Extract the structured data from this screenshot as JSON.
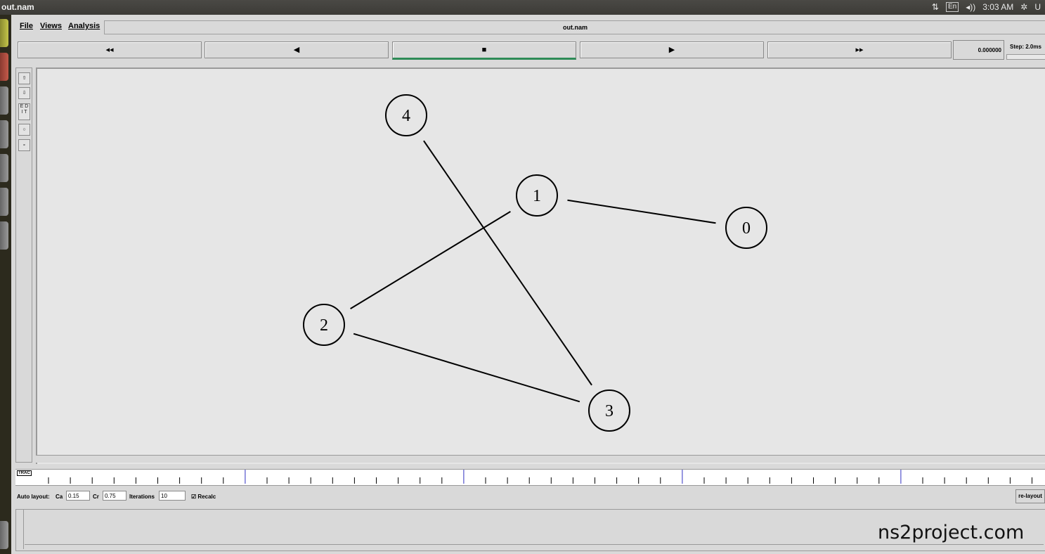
{
  "topbar": {
    "window_title": "out.nam",
    "keyboard_lang": "En",
    "clock": "3:03 AM",
    "user_initial": "U"
  },
  "menu": {
    "file": "File",
    "views": "Views",
    "analysis": "Analysis",
    "title_field": "out.nam"
  },
  "controls": {
    "fast_rewind": "◂◂",
    "rewind": "◀",
    "stop": "■",
    "play": "▶",
    "fast_forward": "▸▸",
    "time": "0.000000",
    "step": "Step: 2.0ms"
  },
  "tools": {
    "edit": "E D I T"
  },
  "graph": {
    "nodes": [
      {
        "id": "0"
      },
      {
        "id": "1"
      },
      {
        "id": "2"
      },
      {
        "id": "3"
      },
      {
        "id": "4"
      }
    ],
    "links": [
      [
        "1",
        "0"
      ],
      [
        "1",
        "2"
      ],
      [
        "2",
        "3"
      ],
      [
        "4",
        "3"
      ]
    ]
  },
  "timeline": {
    "tag": "TRAC"
  },
  "autolayout": {
    "label": "Auto layout:",
    "ca_label": "Ca",
    "ca_value": "0.15",
    "cr_label": "Cr",
    "cr_value": "0.75",
    "iterations_label": "Iterations",
    "iterations_value": "10",
    "recalc_label": "Recalc",
    "relayout": "re-layout"
  },
  "watermark": "ns2project.com"
}
